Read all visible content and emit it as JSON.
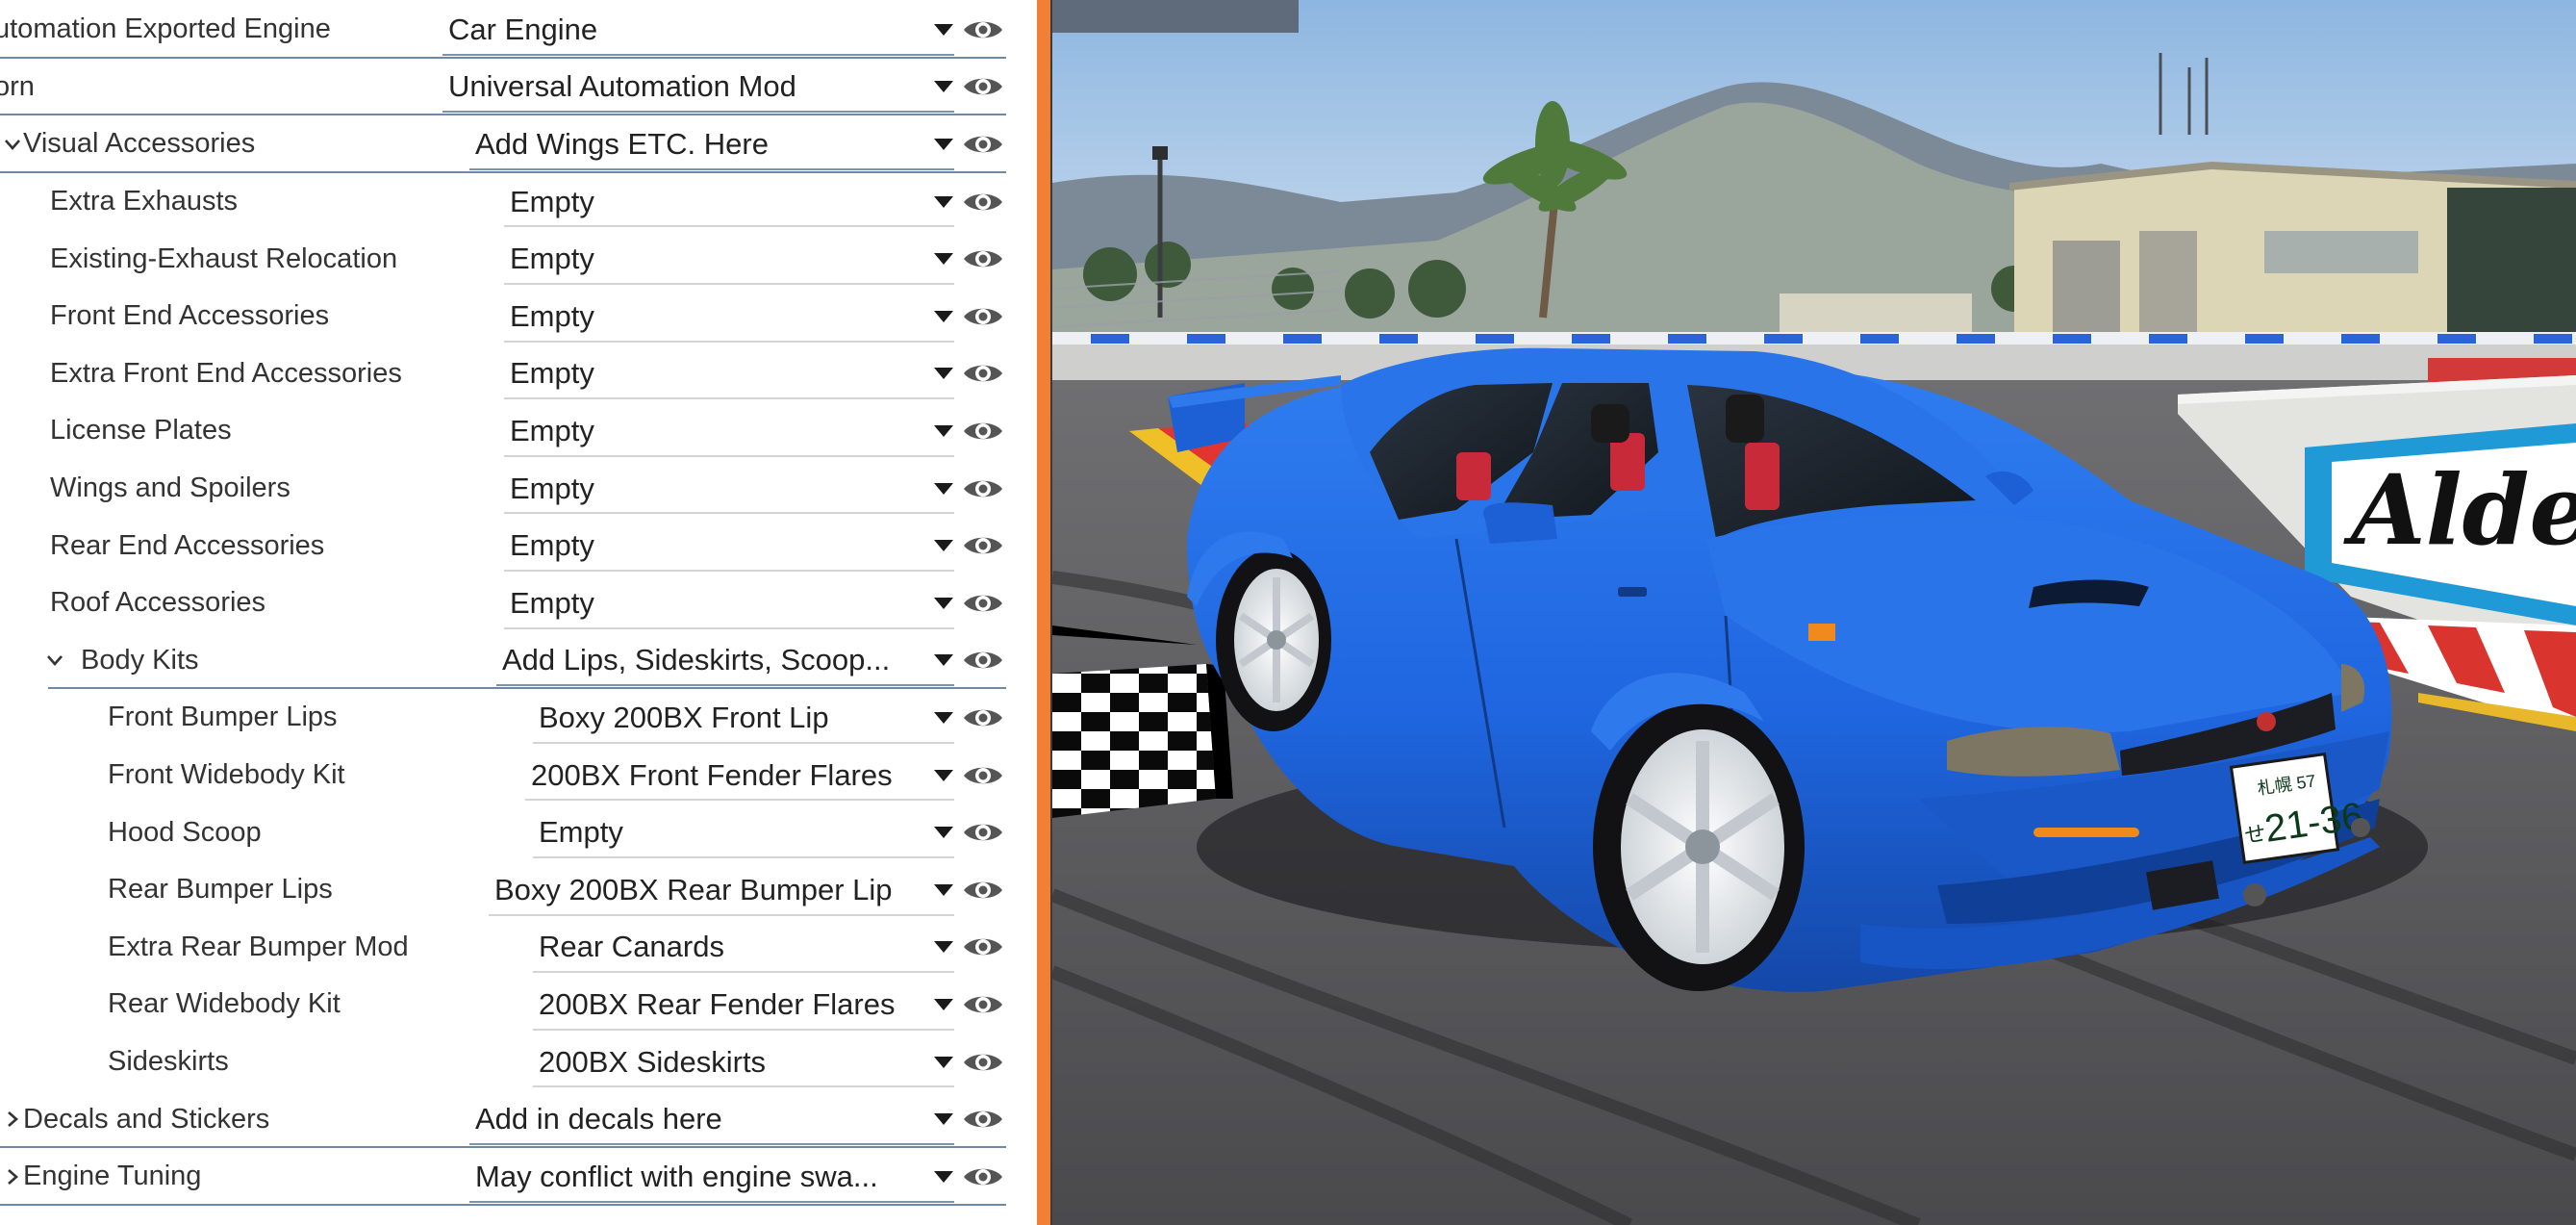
{
  "panel": {
    "rows": [
      {
        "label": "utomation Exported Engine",
        "value": "Car Engine",
        "kind": "category-root"
      },
      {
        "label": "orn",
        "value": "Universal Automation Mod",
        "kind": "category-root"
      },
      {
        "label": "Visual Accessories",
        "value": "Add Wings ETC. Here",
        "kind": "category",
        "expanded": true
      },
      {
        "label": "Extra Exhausts",
        "value": "Empty",
        "kind": "slot"
      },
      {
        "label": "Existing-Exhaust Relocation",
        "value": "Empty",
        "kind": "slot"
      },
      {
        "label": "Front End Accessories",
        "value": "Empty",
        "kind": "slot"
      },
      {
        "label": "Extra Front End Accessories",
        "value": "Empty",
        "kind": "slot"
      },
      {
        "label": "License Plates",
        "value": "Empty",
        "kind": "slot"
      },
      {
        "label": "Wings and Spoilers",
        "value": "Empty",
        "kind": "slot"
      },
      {
        "label": "Rear End Accessories",
        "value": "Empty",
        "kind": "slot"
      },
      {
        "label": "Roof Accessories",
        "value": "Empty",
        "kind": "slot"
      },
      {
        "label": "Body Kits",
        "value": "Add Lips, Sideskirts, Scoop...",
        "kind": "subcategory",
        "expanded": true
      },
      {
        "label": "Front Bumper Lips",
        "value": "Boxy 200BX Front Lip",
        "kind": "subslot"
      },
      {
        "label": "Front Widebody Kit",
        "value": "200BX Front Fender Flares",
        "kind": "subslot"
      },
      {
        "label": "Hood Scoop",
        "value": "Empty",
        "kind": "subslot"
      },
      {
        "label": "Rear Bumper Lips",
        "value": "Boxy 200BX Rear Bumper Lip",
        "kind": "subslot"
      },
      {
        "label": "Extra Rear Bumper Mod",
        "value": "Rear Canards",
        "kind": "subslot"
      },
      {
        "label": "Rear Widebody Kit",
        "value": "200BX Rear Fender Flares",
        "kind": "subslot"
      },
      {
        "label": "Sideskirts",
        "value": "200BX Sideskirts",
        "kind": "subslot"
      },
      {
        "label": "Decals and Stickers",
        "value": "Add in decals here",
        "kind": "category",
        "expanded": false
      },
      {
        "label": "Engine Tuning",
        "value": "May conflict with engine swa...",
        "kind": "category",
        "expanded": false
      }
    ]
  },
  "scene": {
    "billboard_text": "Alde",
    "plate": {
      "top": "札幌 57",
      "kana": "せ",
      "number": "21-36"
    }
  },
  "colors": {
    "accent_border": "#f08036",
    "car_paint": "#1f66e0",
    "separator": "#6d89a6",
    "eye_icon": "#555555"
  },
  "icons": {
    "dropdown": "caret-down-icon",
    "visibility": "eye-icon",
    "expand": "chevron-icon"
  }
}
